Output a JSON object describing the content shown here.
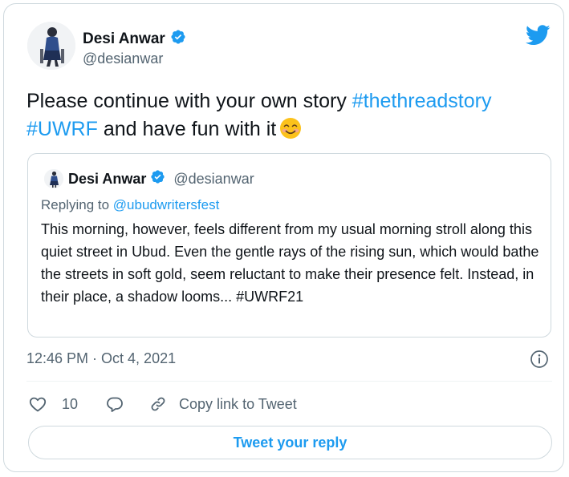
{
  "author": {
    "name": "Desi Anwar",
    "handle": "@desianwar",
    "verified": true
  },
  "tweet": {
    "text_part1": "Please continue with your own story ",
    "hashtag1": "#thethreadstory",
    "hashtag2": "#UWRF",
    "text_part2": " and have fun with it",
    "emoji": "smiling-face-with-smiling-eyes"
  },
  "quoted_tweet": {
    "name": "Desi Anwar",
    "handle": "@desianwar",
    "replying_label": "Replying to ",
    "replying_to": "@ubudwritersfest",
    "text": "This morning, however, feels different from my usual morning stroll along this quiet street in Ubud. Even the gentle rays of the rising sun, which would bathe the streets in soft gold, seem reluctant to make their presence felt. Instead, in their place, a shadow looms... #UWRF21"
  },
  "meta": {
    "timestamp": "12:46 PM · Oct 4, 2021"
  },
  "actions": {
    "like_count": "10",
    "copy_link_label": "Copy link to Tweet"
  },
  "reply_button_label": "Tweet your reply",
  "colors": {
    "accent": "#1d9bf0",
    "verified": "#1d9bf0",
    "text": "#0f1419",
    "secondary": "#536471",
    "border": "#cfd9de"
  },
  "icons": [
    "twitter-bird-icon",
    "verified-badge-icon",
    "info-icon",
    "heart-icon",
    "reply-icon",
    "link-icon"
  ]
}
